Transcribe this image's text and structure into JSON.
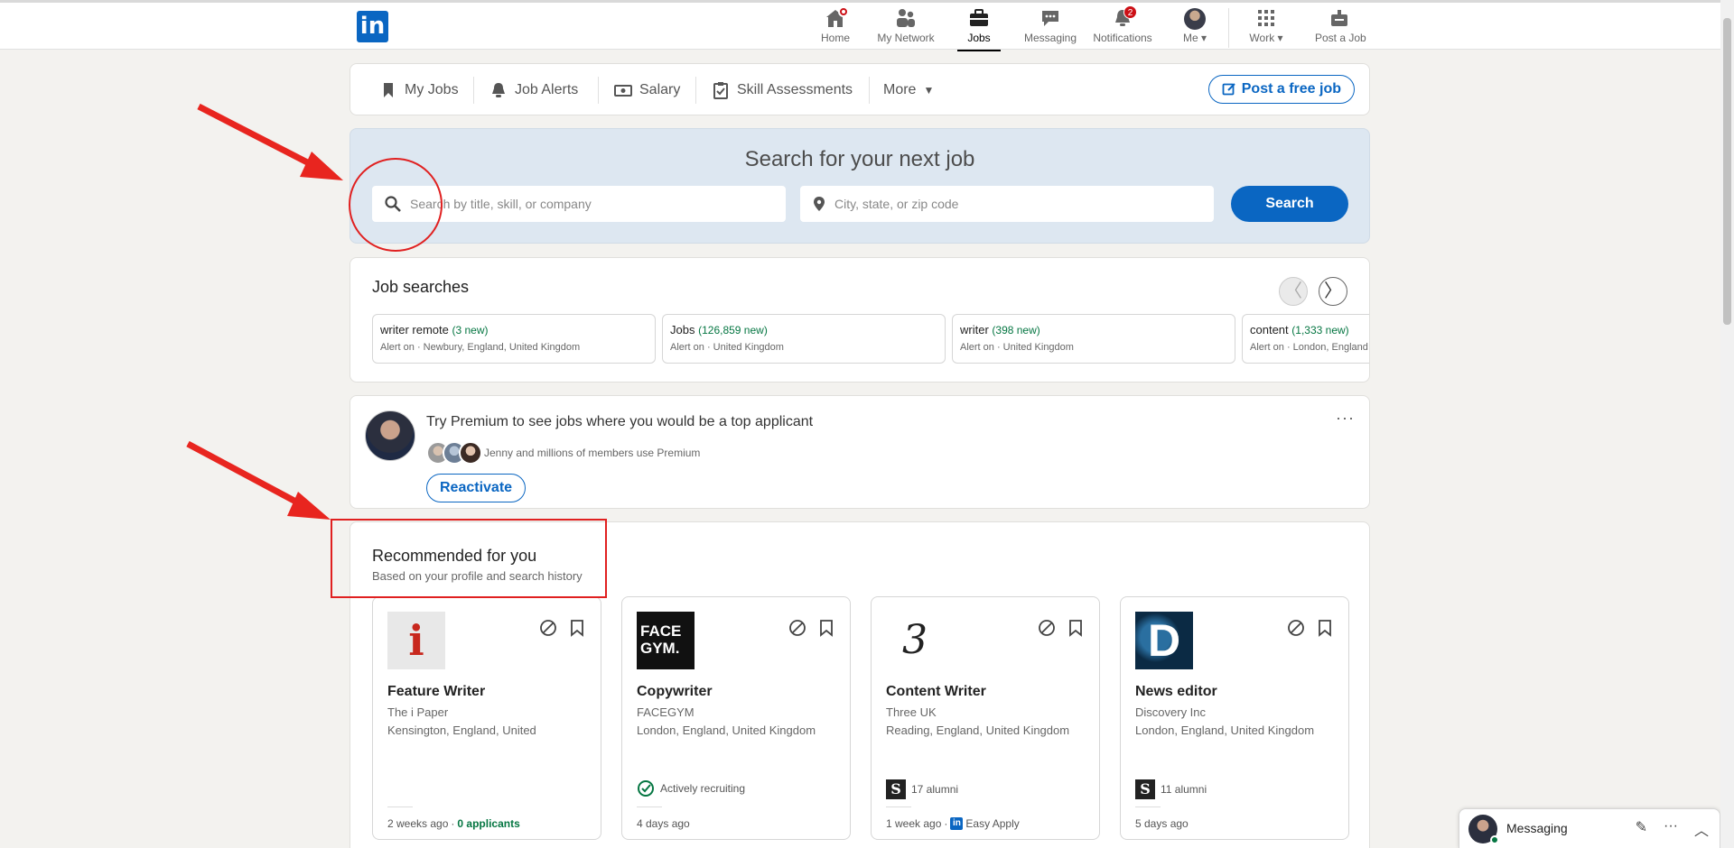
{
  "nav": {
    "logo": "in",
    "items": [
      {
        "label": "Home",
        "icon": "home-icon"
      },
      {
        "label": "My Network",
        "icon": "network-icon"
      },
      {
        "label": "Jobs",
        "icon": "briefcase-icon"
      },
      {
        "label": "Messaging",
        "icon": "messaging-icon"
      },
      {
        "label": "Notifications",
        "icon": "bell-icon",
        "badge": "2"
      },
      {
        "label": "Me",
        "icon": "avatar"
      },
      {
        "label": "Work",
        "icon": "grid-icon"
      },
      {
        "label": "Post a Job",
        "icon": "post-job-icon"
      }
    ]
  },
  "subnav": {
    "my_jobs": "My Jobs",
    "job_alerts": "Job Alerts",
    "salary": "Salary",
    "skill_assessments": "Skill Assessments",
    "more": "More",
    "post_free_job": "Post a free job"
  },
  "search": {
    "heading": "Search for your next job",
    "keyword_placeholder": "Search by title, skill, or company",
    "location_placeholder": "City, state, or zip code",
    "button": "Search"
  },
  "job_searches": {
    "title": "Job searches",
    "prev": "〈",
    "next": "〉",
    "alerts": [
      {
        "query": "writer remote",
        "new": "(3 new)",
        "sub": "Alert on · Newbury, England, United Kingdom"
      },
      {
        "query": "Jobs",
        "new": "(126,859 new)",
        "sub": "Alert on · United Kingdom"
      },
      {
        "query": "writer",
        "new": "(398 new)",
        "sub": "Alert on · United Kingdom"
      },
      {
        "query": "content",
        "new": "(1,333 new)",
        "sub": "Alert on · London, England"
      }
    ]
  },
  "premium": {
    "title": "Try Premium to see jobs where you would be a top applicant",
    "subtitle": "Jenny and millions of members use Premium",
    "button": "Reactivate",
    "menu": "···"
  },
  "recommended": {
    "title": "Recommended for you",
    "subtitle": "Based on your profile and search history",
    "jobs": [
      {
        "title": "Feature Writer",
        "company": "The i Paper",
        "location": "Kensington, England, United",
        "logo_text": "i",
        "meta": "",
        "posted": "2 weeks ago",
        "extra": "0 applicants"
      },
      {
        "title": "Copywriter",
        "company": "FACEGYM",
        "location": "London, England, United Kingdom",
        "logo_text": "FACE GYM.",
        "meta": "Actively recruiting",
        "posted": "4 days ago",
        "extra": ""
      },
      {
        "title": "Content Writer",
        "company": "Three UK",
        "location": "Reading, England, United Kingdom",
        "logo_text": "3",
        "meta": "17 alumni",
        "posted": "1 week ago",
        "extra": "Easy Apply"
      },
      {
        "title": "News editor",
        "company": "Discovery Inc",
        "location": "London, England, United Kingdom",
        "logo_text": "D",
        "meta": "11 alumni",
        "posted": "5 days ago",
        "extra": ""
      }
    ]
  },
  "messaging": {
    "label": "Messaging"
  },
  "colors": {
    "brand": "#0a66c2",
    "annotation": "#e02020",
    "green": "#057642"
  }
}
